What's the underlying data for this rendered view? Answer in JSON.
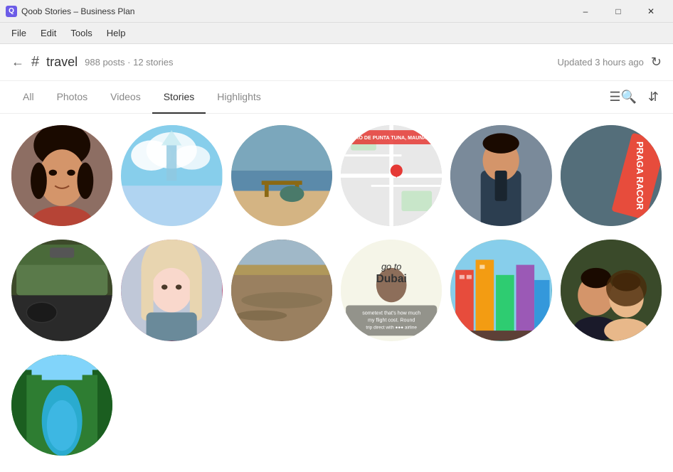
{
  "titleBar": {
    "appTitle": "Qoob Stories – Business Plan",
    "minimize": "–",
    "maximize": "□",
    "close": "✕"
  },
  "menuBar": {
    "items": [
      "File",
      "Edit",
      "Tools",
      "Help"
    ]
  },
  "topBar": {
    "hashtag": "#",
    "tagName": "travel",
    "postCount": "988 posts",
    "storyCount": "12 stories",
    "separator": "·",
    "updatedText": "Updated 3 hours ago",
    "refreshIcon": "↻"
  },
  "tabs": {
    "items": [
      "All",
      "Photos",
      "Videos",
      "Stories",
      "Highlights"
    ],
    "activeIndex": 3
  },
  "toolbar": {
    "searchIcon": "☰🔍",
    "sortIcon": "⇅"
  },
  "stories": [
    {
      "id": 1,
      "type": "face",
      "style": "story-face-1"
    },
    {
      "id": 2,
      "type": "landscape",
      "style": "story-2"
    },
    {
      "id": 3,
      "type": "beach",
      "style": "story-3"
    },
    {
      "id": 4,
      "type": "map",
      "style": "story-4"
    },
    {
      "id": 5,
      "type": "person",
      "style": "story-5"
    },
    {
      "id": 6,
      "type": "car",
      "style": "story-6"
    },
    {
      "id": 7,
      "type": "face2",
      "style": "story-face-2"
    },
    {
      "id": 8,
      "type": "water",
      "style": "story-8"
    },
    {
      "id": 9,
      "type": "dubai",
      "style": "story-9"
    },
    {
      "id": 10,
      "type": "colorful",
      "style": "story-10"
    },
    {
      "id": 11,
      "type": "nature",
      "style": "story-11"
    },
    {
      "id": 12,
      "type": "article",
      "style": "story-12"
    },
    {
      "id": 13,
      "type": "selfie",
      "style": "story-13"
    },
    {
      "id": 14,
      "type": "river",
      "style": "story-14"
    }
  ]
}
